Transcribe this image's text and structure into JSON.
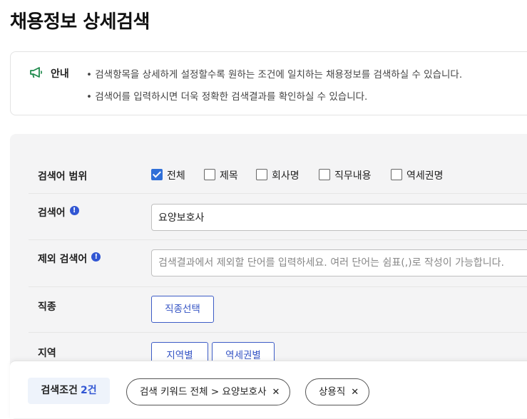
{
  "page": {
    "title": "채용정보 상세검색"
  },
  "notice": {
    "label": "안내",
    "lines": [
      "• 검색항목을 상세하게 설정할수록 원하는 조건에 일치하는 채용정보를 검색하실 수 있습니다.",
      "• 검색어를 입력하시면 더욱 정확한 검색결과를 확인하실 수 있습니다."
    ]
  },
  "form": {
    "scope": {
      "label": "검색어 범위",
      "options": [
        {
          "label": "전체",
          "checked": true
        },
        {
          "label": "제목",
          "checked": false
        },
        {
          "label": "회사명",
          "checked": false
        },
        {
          "label": "직무내용",
          "checked": false
        },
        {
          "label": "역세권명",
          "checked": false
        }
      ]
    },
    "keyword": {
      "label": "검색어",
      "value": "요양보호사"
    },
    "exclude": {
      "label": "제외 검색어",
      "placeholder": "검색결과에서 제외할 단어를 입력하세요. 여러 단어는 쉼표(,)로 작성이 가능합니다."
    },
    "job": {
      "label": "직종",
      "button": "직종선택"
    },
    "region": {
      "label": "지역",
      "buttons": [
        "지역별",
        "역세권별"
      ]
    }
  },
  "conditions": {
    "label": "검색조건",
    "count": "2건",
    "chips": [
      "검색 키워드 전체 > 요양보호사",
      "상용직"
    ],
    "remove_glyph": "✕"
  },
  "colors": {
    "accent": "#3156d3",
    "checkbox": "#2f6fd8",
    "panel_bg": "#f4f4f5",
    "notice_icon": "#1f8a4c"
  }
}
